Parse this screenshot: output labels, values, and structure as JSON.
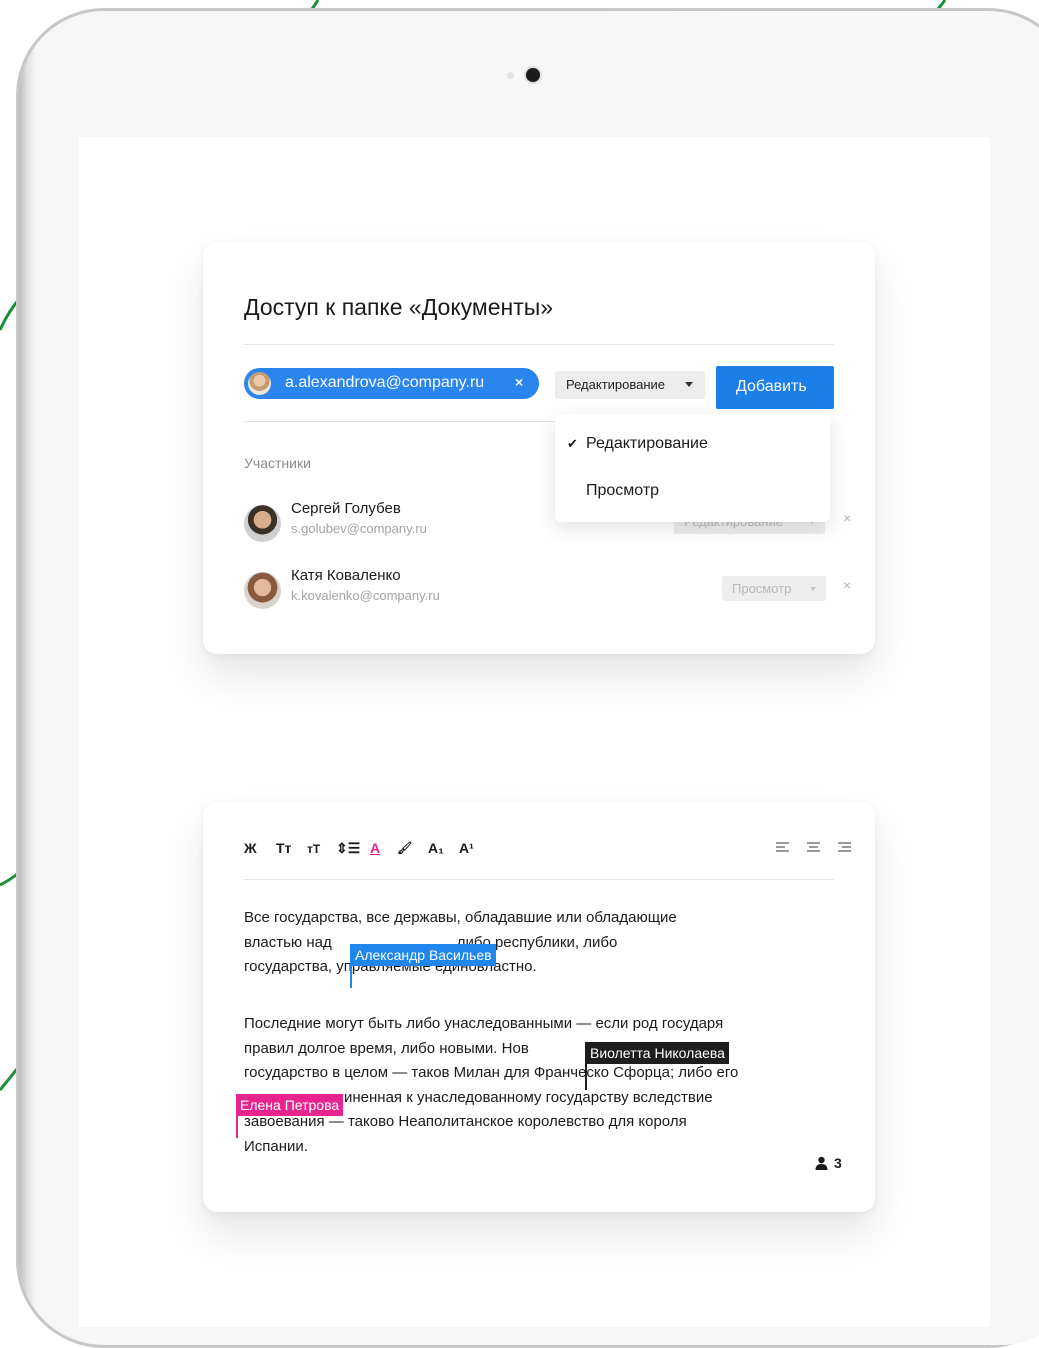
{
  "share_dialog": {
    "title": "Доступ к папке «Документы»",
    "invite_chip": {
      "email": "a.alexandrova@company.ru",
      "remove": "×"
    },
    "role_select": {
      "value": "Редактирование"
    },
    "add_button": "Добавить",
    "participants_label": "Участники",
    "members": [
      {
        "name": "Сергей Голубев",
        "email": "s.golubev@company.ru",
        "permission": "Редактирование",
        "remove": "×"
      },
      {
        "name": "Катя Коваленко",
        "email": "k.kovalenko@company.ru",
        "permission": "Просмотр",
        "remove": "×"
      }
    ],
    "role_dropdown": {
      "options": [
        {
          "label": "Редактирование",
          "checked": true
        },
        {
          "label": "Просмотр",
          "checked": false
        }
      ],
      "check_mark": "✔"
    }
  },
  "editor": {
    "toolbar": {
      "bold": "Ж",
      "text_size_down": "Tт",
      "text_size_up": "тT",
      "line_spacing": "⇕☰",
      "text_color": "A",
      "highlight": "🖌",
      "subscript": "A₁",
      "superscript": "A¹"
    },
    "paragraph_1": "Все государства, все державы, обладавшие или обладающие\nвластью над                              либо республики, либо\nгосударства, управляемые единовластно.",
    "paragraph_2": "Последние могут быть либо унаследованными — если род государя\nправил долгое время, либо новыми. Нов\nгосударство в целом — таков Милан для Франческо Сфорца; либо его\n                        иненная к унаследованному государству вследствие\nзавоевания — таково Неаполитанское королевство для короля\nИспании.",
    "cursors": [
      {
        "name": "Александр Васильев",
        "color": "#1f86ed"
      },
      {
        "name": "Виолетта Николаева",
        "color": "#1e1e1e"
      },
      {
        "name": "Елена Петрова",
        "color": "#e8258f"
      }
    ],
    "collaborators_count": "3",
    "collaborators_icon": "user-icon"
  },
  "colors": {
    "accent": "#1b7fea",
    "deco_green": "#1a8f3a"
  }
}
